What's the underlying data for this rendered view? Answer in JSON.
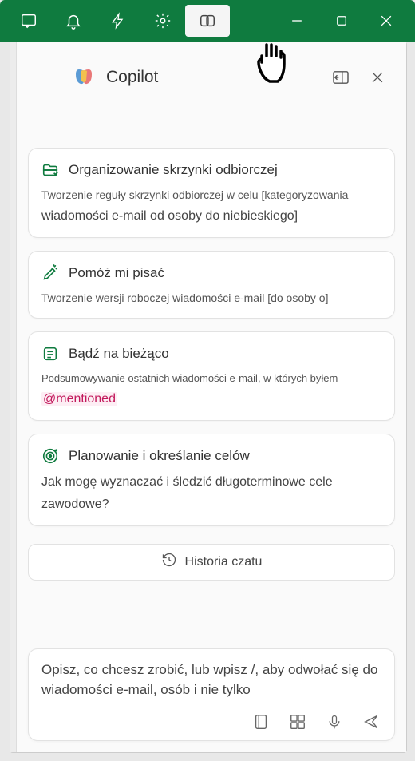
{
  "titlebar": {
    "icons": [
      "todo-icon",
      "bell-icon",
      "bolt-icon",
      "gear-icon",
      "copilot-icon"
    ],
    "window": [
      "minimize",
      "maximize",
      "close"
    ]
  },
  "header": {
    "title": "Copilot"
  },
  "cards": [
    {
      "icon": "inbox-organize-icon",
      "title": "Organizowanie skrzynki odbiorczej",
      "line1": "Tworzenie reguły skrzynki odbiorczej w celu [kategoryzowania",
      "line2": "wiadomości e-mail od osoby do niebieskiego]"
    },
    {
      "icon": "write-assist-icon",
      "title": "Pomóż mi pisać",
      "line1": "Tworzenie wersji roboczej wiadomości e-mail [do osoby o]",
      "line2": ""
    },
    {
      "icon": "stay-current-icon",
      "title": "Bądź na bieżąco",
      "line1": "Podsumowywanie ostatnich wiadomości e-mail, w których byłem",
      "mention": "@mentioned"
    },
    {
      "icon": "goals-icon",
      "title": "Planowanie i określanie celów",
      "line1": "Jak mogę wyznaczać i śledzić długoterminowe cele",
      "line2": "zawodowe?"
    }
  ],
  "history": {
    "label": "Historia czatu"
  },
  "input": {
    "placeholder": "Opisz, co chcesz zrobić, lub wpisz /, aby odwołać się do wiadomości e-mail, osób i nie tylko"
  }
}
